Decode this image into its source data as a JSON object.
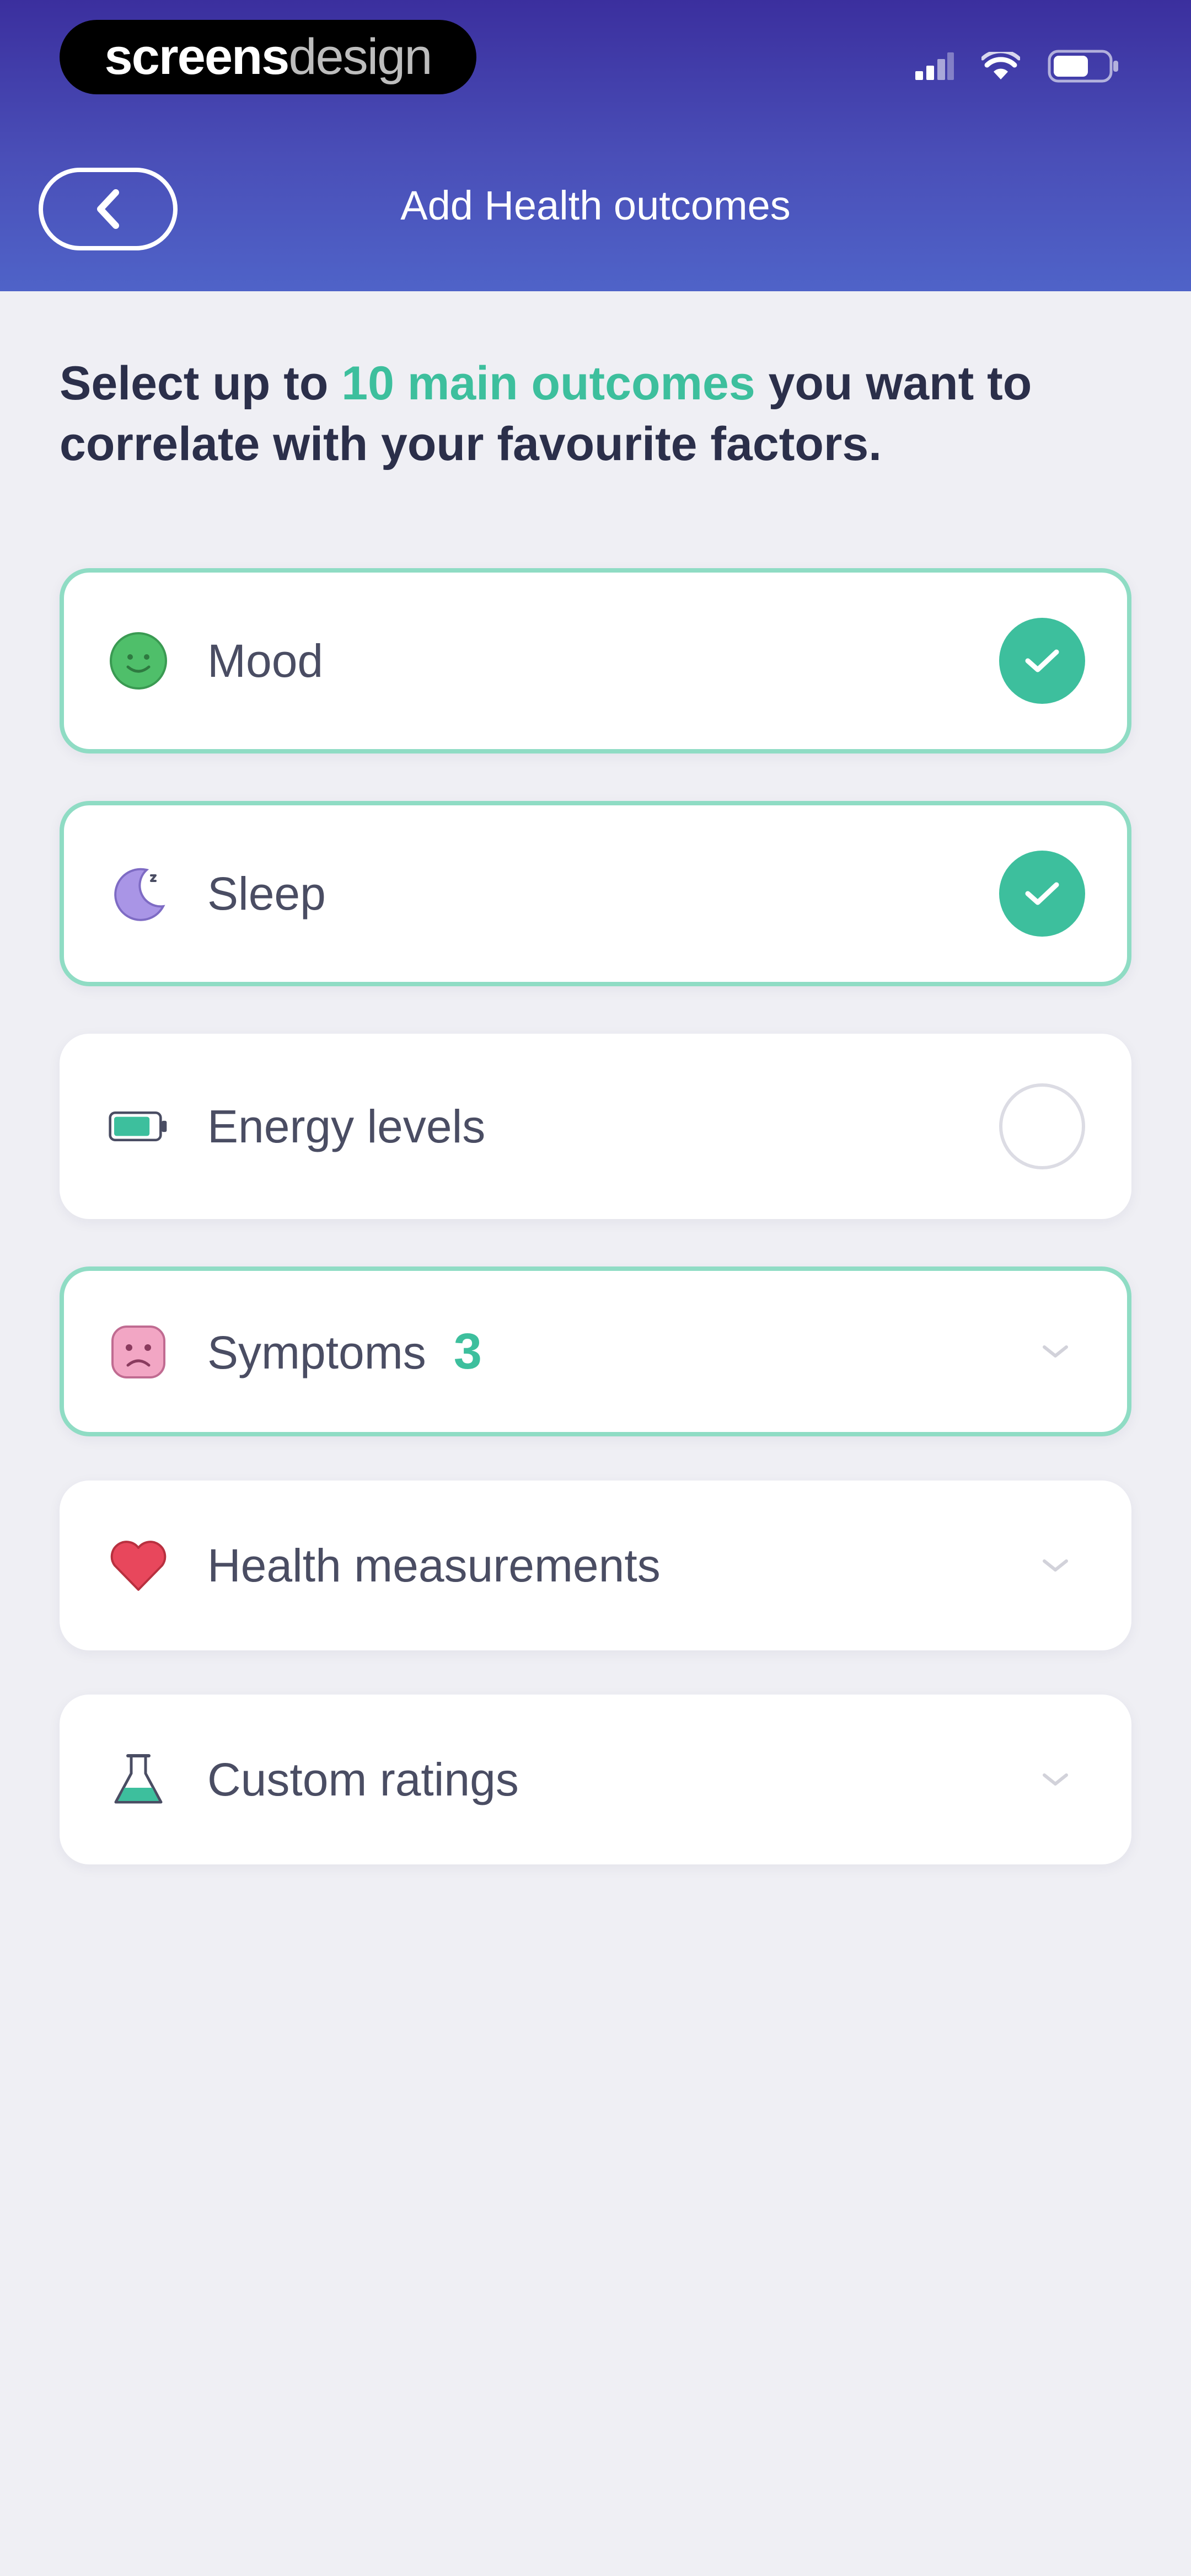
{
  "status_bar": {
    "brand_strong": "screens",
    "brand_light": "design"
  },
  "header": {
    "title": "Add Health outcomes"
  },
  "instructions": {
    "prefix": "Select up to ",
    "highlight": "10 main outcomes",
    "suffix": " you want to correlate with your favourite factors."
  },
  "options": [
    {
      "label": "Mood",
      "selected": true,
      "icon": "mood-face-icon"
    },
    {
      "label": "Sleep",
      "selected": true,
      "icon": "moon-icon"
    },
    {
      "label": "Energy levels",
      "selected": false,
      "icon": "battery-icon"
    },
    {
      "label": "Symptoms",
      "count": "3",
      "icon": "symptom-face-icon"
    },
    {
      "label": "Health measurements",
      "icon": "heart-icon"
    },
    {
      "label": "Custom ratings",
      "icon": "flask-icon"
    }
  ],
  "colors": {
    "accent": "#3dbf9d",
    "header_top": "#3b2f9e",
    "header_bottom": "#4f63c8",
    "background": "#efeff4",
    "text_dark": "#2b2f4a"
  }
}
